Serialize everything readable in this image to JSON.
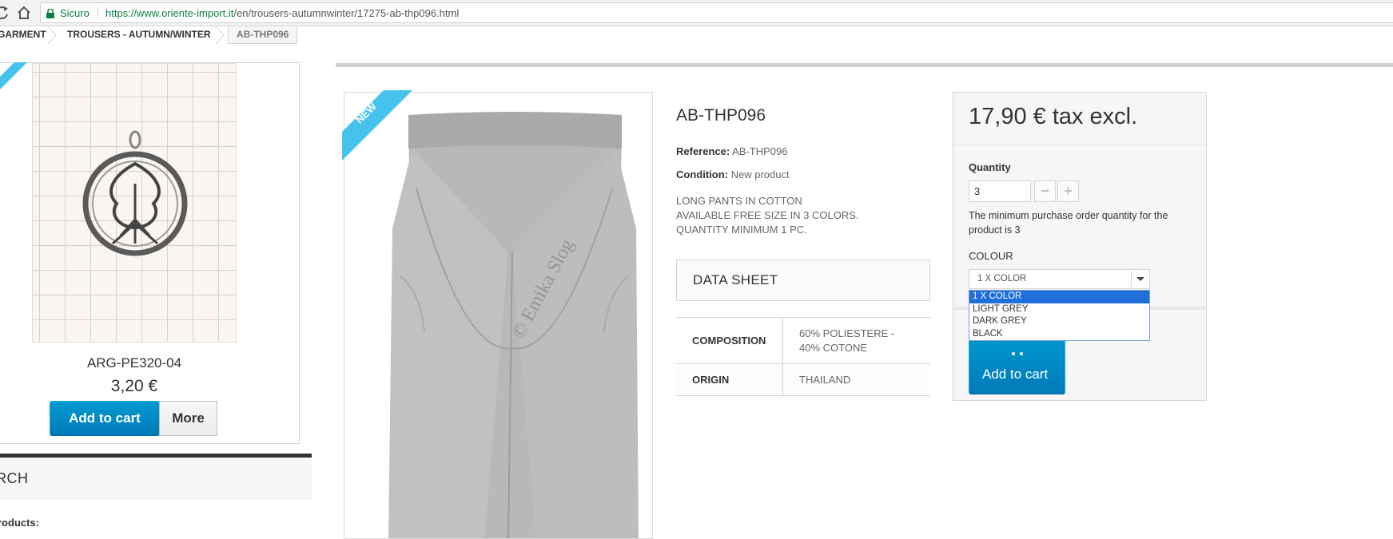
{
  "browser": {
    "secure_label": "Sicuro",
    "url_host": "https://www.oriente-import.it",
    "url_path": "/en/trousers-autumnwinter/17275-ab-thp096.html"
  },
  "breadcrumb": {
    "items": [
      "GARMENT",
      "TROUSERS - AUTUMN/WINTER",
      "AB-THP096"
    ]
  },
  "sidebar": {
    "product_name": "ARG-PE320-04",
    "product_price": "3,20 €",
    "add_to_cart_label": "Add to cart",
    "more_label": "More",
    "search_title": "RCH",
    "products_label": "roducts:"
  },
  "product": {
    "badge": "NEW",
    "watermark": "© Emika Slog",
    "title": "AB-THP096",
    "reference_label": "Reference:",
    "reference_value": "AB-THP096",
    "condition_label": "Condition:",
    "condition_value": "New product",
    "description": [
      "LONG PANTS IN COTTON",
      "AVAILABLE FREE SIZE IN 3 COLORS.",
      "QUANTITY MINIMUM 1 PC."
    ],
    "datasheet_title": "DATA SHEET",
    "datasheet": [
      {
        "key": "COMPOSITION",
        "value": "60% POLIESTERE - 40% COTONE"
      },
      {
        "key": "ORIGIN",
        "value": "THAILAND"
      }
    ]
  },
  "buybox": {
    "price": "17,90 € tax excl.",
    "quantity_label": "Quantity",
    "quantity_value": "3",
    "minus": "−",
    "plus": "+",
    "min_note": "The minimum purchase order quantity for the product is 3",
    "colour_label": "COLOUR",
    "colour_selected": "1 X COLOR",
    "colour_options": [
      "1 X COLOR",
      "LIGHT GREY",
      "DARK GREY",
      "BLACK"
    ],
    "add_to_cart_label": "Add to cart"
  },
  "colors": {
    "accent": "#0079b6",
    "ribbon": "#45c3ee",
    "secure": "#0b8043",
    "select_highlight": "#1e6fd9"
  }
}
